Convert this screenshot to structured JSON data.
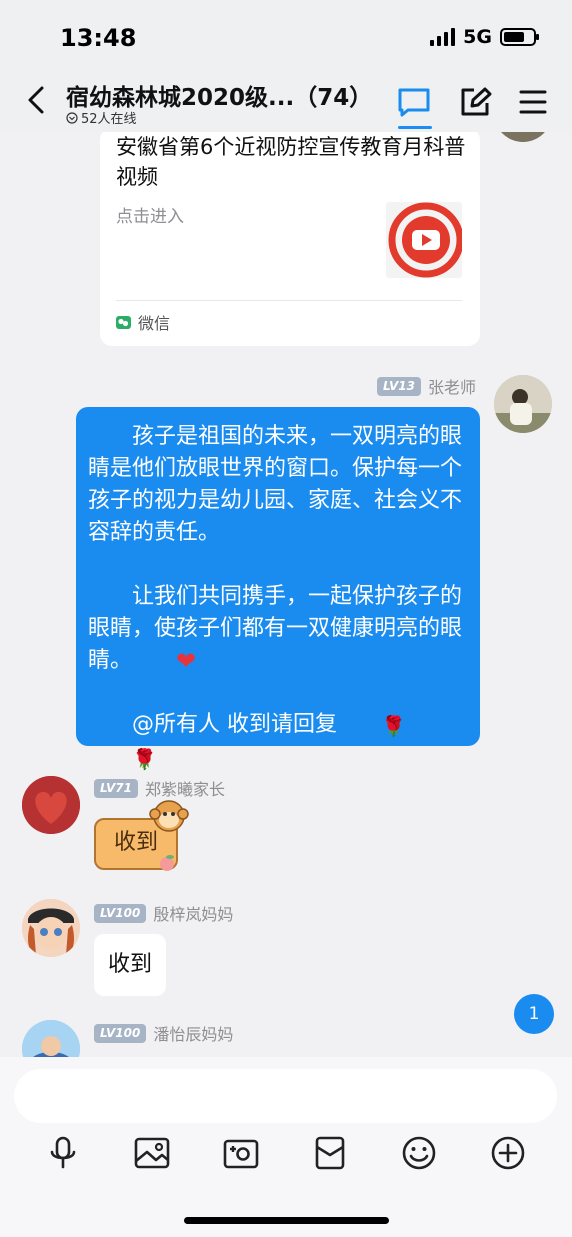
{
  "status": {
    "time": "13:48",
    "network": "5G"
  },
  "header": {
    "title": "宿幼森林城2020级...（74）",
    "online": "52人在线"
  },
  "share_card": {
    "title": "安徽省第6个近视防控宣传教育月科普视频",
    "subtitle": "点击进入",
    "source": "微信"
  },
  "messages": [
    {
      "sender": "张老师",
      "level": "LV13",
      "paragraphs": [
        "孩子是祖国的未来，一双明亮的眼睛是他们放眼世界的窗口。保护每一个孩子的视力是幼儿园、家庭、社会义不容辞的责任。",
        "让我们共同携手，一起保护孩子的眼睛，使孩子们都有一双健康明亮的眼睛。",
        "@所有人 收到请回复"
      ],
      "emoji": {
        "heart": "❤",
        "rose": "🌹"
      }
    },
    {
      "sender": "郑紫曦家长",
      "level": "LV71",
      "text": "收到"
    },
    {
      "sender": "殷梓岚妈妈",
      "level": "LV100",
      "text": "收到"
    },
    {
      "sender": "潘怡辰妈妈",
      "level": "LV100"
    }
  ],
  "unread_count": "1",
  "colors": {
    "accent": "#1a8cf0",
    "background": "#f1f1f3",
    "level_badge": "#a7b4c6"
  },
  "icons": [
    "back-icon",
    "chat-icon",
    "edit-icon",
    "menu-icon",
    "voice-icon",
    "image-icon",
    "camera-icon",
    "red-packet-icon",
    "emoji-icon",
    "plus-icon"
  ]
}
